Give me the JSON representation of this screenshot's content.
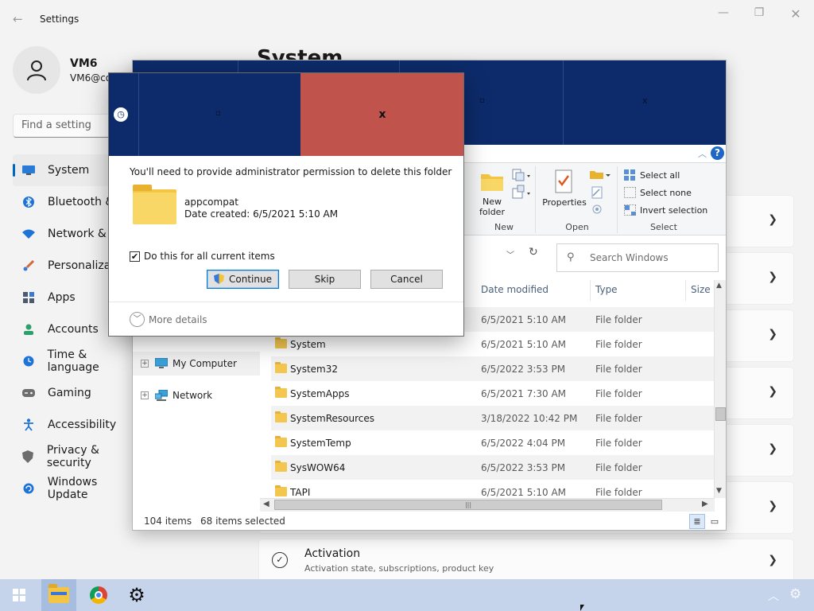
{
  "settings": {
    "window_title": "Settings",
    "user": {
      "name": "VM6",
      "email": "VM6@co"
    },
    "search_placeholder": "Find a setting",
    "page_title": "System",
    "nav": [
      {
        "label": "System",
        "icon": "monitor-icon",
        "color": "#2a7bd6"
      },
      {
        "label": "Bluetooth &",
        "icon": "bluetooth-icon",
        "color": "#1e73d6"
      },
      {
        "label": "Network & i",
        "icon": "wifi-icon",
        "color": "#1e73d6"
      },
      {
        "label": "Personalizat",
        "icon": "brush-icon",
        "color": "#d16a3a"
      },
      {
        "label": "Apps",
        "icon": "apps-icon",
        "color": "#4a5a70"
      },
      {
        "label": "Accounts",
        "icon": "person-icon",
        "color": "#2aa06a"
      },
      {
        "label": "Time & language",
        "icon": "clock-globe-icon",
        "color": "#1e73d6"
      },
      {
        "label": "Gaming",
        "icon": "gamepad-icon",
        "color": "#6d6d6d"
      },
      {
        "label": "Accessibility",
        "icon": "accessibility-icon",
        "color": "#1e73d6"
      },
      {
        "label": "Privacy & security",
        "icon": "shield-icon",
        "color": "#6d6d6d"
      },
      {
        "label": "Windows Update",
        "icon": "update-icon",
        "color": "#1e73d6"
      }
    ],
    "activation": {
      "title": "Activation",
      "subtitle": "Activation state, subscriptions, product key"
    }
  },
  "explorer": {
    "ribbon": {
      "new_folder_label": "New folder",
      "properties_label": "Properties",
      "select_all": "Select all",
      "select_none": "Select none",
      "invert_selection": "Invert selection",
      "groups": {
        "new": "New",
        "open": "Open",
        "select": "Select"
      }
    },
    "search_placeholder": "Search Windows",
    "nav_tree": [
      {
        "label": "My Computer",
        "icon": "computer-icon"
      },
      {
        "label": "Network",
        "icon": "network-icon"
      }
    ],
    "columns": {
      "date": "Date modified",
      "type": "Type",
      "size": "Size"
    },
    "rows": [
      {
        "name": "",
        "date": "6/5/2021 5:10 AM",
        "type": "File folder"
      },
      {
        "name": "System",
        "date": "6/5/2021 5:10 AM",
        "type": "File folder"
      },
      {
        "name": "System32",
        "date": "6/5/2022 3:53 PM",
        "type": "File folder"
      },
      {
        "name": "SystemApps",
        "date": "6/5/2021 7:30 AM",
        "type": "File folder"
      },
      {
        "name": "SystemResources",
        "date": "3/18/2022 10:42 PM",
        "type": "File folder"
      },
      {
        "name": "SystemTemp",
        "date": "6/5/2022 4:04 PM",
        "type": "File folder"
      },
      {
        "name": "SysWOW64",
        "date": "6/5/2022 3:53 PM",
        "type": "File folder"
      },
      {
        "name": "TAPI",
        "date": "6/5/2021 5:10 AM",
        "type": "File folder"
      }
    ],
    "status": {
      "items": "104 items",
      "selected": "68 items selected"
    },
    "titlebar_glyphs": {
      "maximize": "▫",
      "close": "x"
    }
  },
  "dialog": {
    "message": "You'll need to provide administrator permission to delete this folder",
    "folder_name": "appcompat",
    "folder_date": "Date created: 6/5/2021 5:10 AM",
    "checkbox_label": "Do this for all current items",
    "checkbox_mark": "✔",
    "buttons": {
      "continue": "Continue",
      "skip": "Skip",
      "cancel": "Cancel"
    },
    "more_details": "More details",
    "titlebar_glyphs": {
      "maximize": "▫",
      "close": "x"
    },
    "colors": {
      "titlebar": "#0d2b6b",
      "close": "#c0544d"
    }
  },
  "taskbar": {
    "apps": [
      {
        "name": "start",
        "icon": "windows-logo-icon"
      },
      {
        "name": "file-explorer",
        "icon": "folder-icon"
      },
      {
        "name": "chrome",
        "icon": "chrome-icon"
      },
      {
        "name": "settings",
        "icon": "gear-icon"
      }
    ],
    "color": "#c5d4ea"
  }
}
